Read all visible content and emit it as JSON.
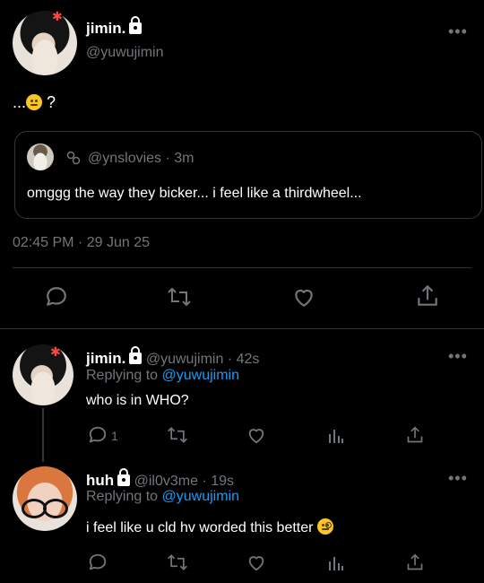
{
  "main_tweet": {
    "display_name": "jimin.",
    "handle": "@yuwujimin",
    "text_prefix": "...",
    "text_suffix": " ?",
    "timestamp": "02:45 PM · 29 Jun 25"
  },
  "quoted_tweet": {
    "handle": "@ynslovies",
    "time": "· 3m",
    "text": "omggg the way they bicker... i feel like a thirdwheel..."
  },
  "replies": [
    {
      "display_name": "jimin.",
      "handle": "@yuwujimin",
      "time": "· 42s",
      "replying_label": "Replying to",
      "replying_to": "@yuwujimin",
      "text": "who is in WHO?",
      "reply_count": "1"
    },
    {
      "display_name": "huh",
      "handle": "@il0v3me",
      "time": "· 19s",
      "replying_label": "Replying to",
      "replying_to": "@yuwujimin",
      "text": "i feel like u cld hv worded this better "
    }
  ],
  "colors": {
    "background": "#000000",
    "text": "#e7e9ea",
    "muted": "#71767b",
    "link": "#1d9bf0",
    "border": "#2f3336"
  },
  "icons": [
    "more-icon",
    "lock-icon",
    "reply-icon",
    "retweet-icon",
    "like-icon",
    "share-icon",
    "analytics-icon",
    "circles-icon"
  ]
}
